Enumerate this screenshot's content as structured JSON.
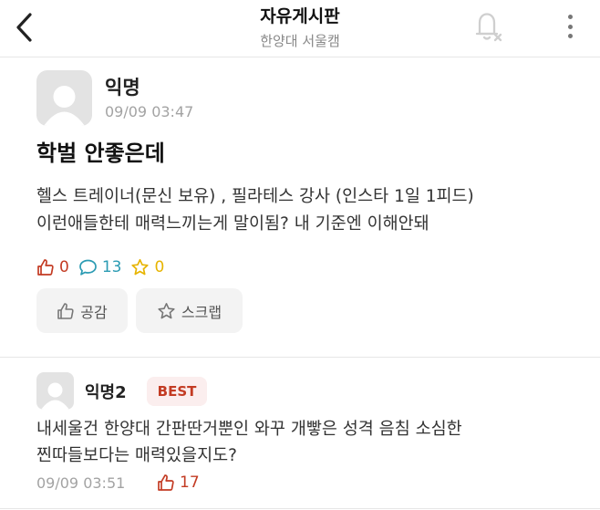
{
  "header": {
    "title": "자유게시판",
    "subtitle": "한양대 서울캠"
  },
  "post": {
    "author": "익명",
    "time": "09/09 03:47",
    "title": "학벌 안좋은데",
    "body_lines": [
      "헬스 트레이너(문신 보유) , 필라테스 강사 (인스타 1일 1피드)",
      "이런애들한테 매력느끼는게 말이됨? 내 기준엔 이해안돼"
    ],
    "likes": "0",
    "comments": "13",
    "scraps": "0",
    "like_button": "공감",
    "scrap_button": "스크랩"
  },
  "comment": {
    "author": "익명2",
    "badge": "BEST",
    "body_lines": [
      "내세울건 한양대 간판딴거뿐인 와꾸 개빻은 성격 음침 소심한",
      "찐따들보다는 매력있을지도?"
    ],
    "time": "09/09 03:51",
    "likes": "17"
  },
  "colors": {
    "like": "#c33b23",
    "comment": "#2b9bb3",
    "scrap": "#e7b400",
    "muted": "#a3a3a3"
  },
  "icons": [
    "back-icon",
    "notification-off-icon",
    "more-icon",
    "thumbs-up-icon",
    "comment-icon",
    "star-icon"
  ]
}
